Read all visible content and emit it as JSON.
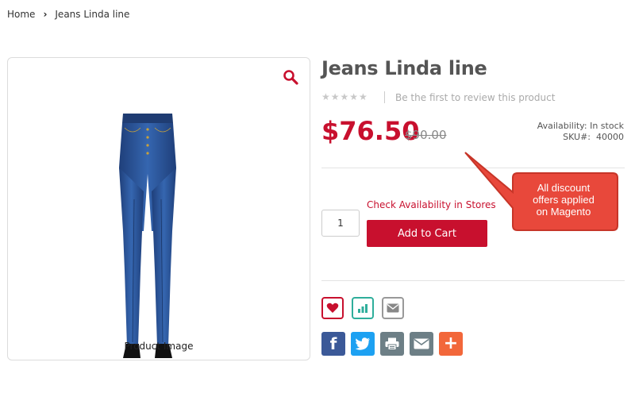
{
  "breadcrumb": {
    "home": "Home",
    "separator": "›",
    "current": "Jeans Linda line"
  },
  "image_panel": {
    "caption": "Product Image",
    "zoom_icon": "magnifier-icon"
  },
  "product": {
    "title": "Jeans Linda line",
    "stars": "★★★★★",
    "review_link": "Be the first to review this product",
    "price": "$76.50",
    "old_price": "$90.00",
    "availability": "Availability: In stock",
    "sku": "SKU#:  40000"
  },
  "cart": {
    "check_stores": "Check Availability in Stores",
    "quantity": "1",
    "add_to_cart": "Add to Cart"
  },
  "callout": {
    "line1": "All discount",
    "line2": "offers applied",
    "line3": "on Magento"
  },
  "actions": {
    "wishlist": "heart-icon",
    "compare": "bar-chart-icon",
    "email": "envelope-icon"
  },
  "share": {
    "facebook": "f",
    "more": "+"
  },
  "colors": {
    "accent": "#c8102e",
    "facebook": "#3b5998",
    "twitter": "#1da1f2",
    "grey": "#6d7f86",
    "orange": "#f2673a",
    "teal": "#2fae9b"
  }
}
